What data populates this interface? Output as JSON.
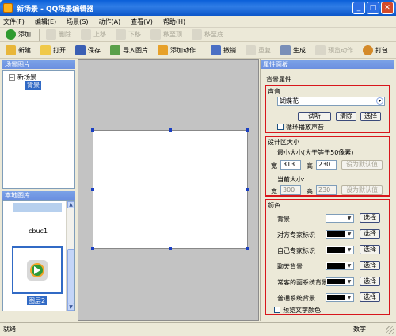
{
  "window": {
    "title": "新场景 - QQ场景编辑器",
    "buttons": [
      "_",
      "□",
      "✕"
    ]
  },
  "menu": [
    "文件(F)",
    "编辑(E)",
    "场景(S)",
    "动作(A)",
    "查看(V)",
    "帮助(H)"
  ],
  "toolbar1": [
    {
      "label": "添加",
      "enabled": true
    },
    {
      "label": "删除",
      "enabled": false
    },
    {
      "label": "上移",
      "enabled": false
    },
    {
      "label": "下移",
      "enabled": false
    },
    {
      "label": "移至顶",
      "enabled": false
    },
    {
      "label": "移至底",
      "enabled": false
    }
  ],
  "toolbar2": [
    {
      "label": "新建",
      "enabled": true
    },
    {
      "label": "打开",
      "enabled": true
    },
    {
      "label": "保存",
      "enabled": true
    },
    {
      "label": "导入图片",
      "enabled": true
    },
    {
      "label": "添加动作",
      "enabled": true
    },
    {
      "label": "撤销",
      "enabled": true
    },
    {
      "label": "重复",
      "enabled": false
    },
    {
      "label": "生成",
      "enabled": true
    },
    {
      "label": "预览动作",
      "enabled": false
    },
    {
      "label": "打包",
      "enabled": true
    }
  ],
  "left": {
    "tree_header": "场景图片",
    "tree_root": "新场景",
    "tree_child": "背景",
    "thumbs_header": "本地图库",
    "thumb_label_1": "cbuc1",
    "thumb_label_2": "图层2"
  },
  "props": {
    "header": "属性面板",
    "section_title": "背景属性",
    "sound": {
      "group_label": "声音",
      "selected": "蝴蝶花",
      "listen": "试听",
      "clear": "清除",
      "choose": "选择",
      "loop_label": "循环播放声音"
    },
    "size": {
      "group_label": "设计区大小",
      "max_label": "最小大小(大于等于50像素)",
      "width_label": "宽",
      "width_value": "313",
      "height_label": "高",
      "height_value": "230",
      "set_default": "设为默认值",
      "current_label": "当前大小:",
      "cur_width": "300",
      "cur_height": "230",
      "set_current": "设为默认值"
    },
    "colors": {
      "group_label": "颜色",
      "choose": "选择",
      "rows": [
        {
          "label": "背景",
          "color": "#ffffff"
        },
        {
          "label": "对方专家标识",
          "color": "#000000"
        },
        {
          "label": "自己专家标识",
          "color": "#000000"
        },
        {
          "label": "聊天背景",
          "color": "#000000"
        },
        {
          "label": "常客的面系统背景",
          "color": "#000000"
        },
        {
          "label": "普通系统背景",
          "color": "#000000"
        }
      ],
      "preview_label": "预览文字颜色"
    }
  },
  "status": {
    "left": "就绪",
    "right": "数字"
  }
}
